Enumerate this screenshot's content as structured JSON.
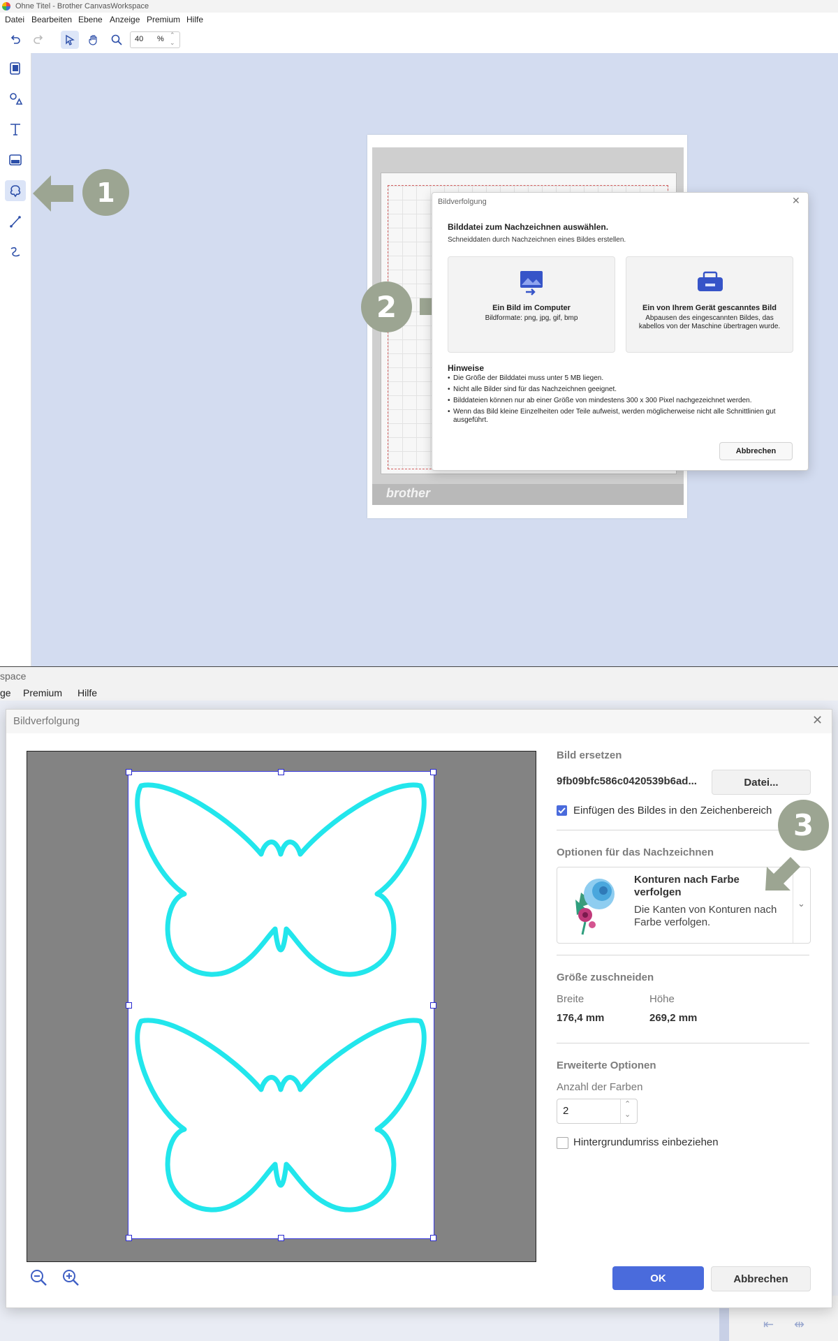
{
  "top": {
    "window_title": "Ohne Titel - Brother CanvasWorkspace",
    "menu": [
      "Datei",
      "Bearbeiten",
      "Ebene",
      "Anzeige",
      "Premium",
      "Hilfe"
    ],
    "zoom_value": "40",
    "zoom_unit": "%",
    "left_tools": [
      "pages-icon",
      "shapes-icon",
      "text-icon",
      "svg-import-icon",
      "image-trace-icon",
      "line-icon",
      "curve-icon"
    ],
    "mat_logo": "brother",
    "dialog": {
      "title": "Bildverfolgung",
      "heading": "Bilddatei zum Nachzeichnen auswählen.",
      "subheading": "Schneiddaten durch Nachzeichnen eines Bildes erstellen.",
      "option_computer": {
        "title": "Ein Bild im Computer",
        "desc": "Bildformate: png, jpg, gif, bmp"
      },
      "option_scan": {
        "title": "Ein von Ihrem Gerät gescanntes Bild",
        "desc": "Abpausen des eingescannten Bildes, das kabellos von der Maschine übertragen wurde."
      },
      "notes_heading": "Hinweise",
      "notes": [
        "Die Größe der Bilddatei muss unter 5 MB liegen.",
        "Nicht alle Bilder sind für das Nachzeichnen geeignet.",
        "Bilddateien können nur ab einer Größe von mindestens 300 x 300 Pixel nachgezeichnet werden.",
        "Wenn das Bild kleine Einzelheiten oder Teile aufweist, werden möglicherweise nicht alle Schnittlinien gut ausgeführt."
      ],
      "cancel": "Abbrechen"
    },
    "step1": "1",
    "step2": "2"
  },
  "bottom": {
    "window_title_partial": "space",
    "menu_partial": [
      "ge",
      "Premium",
      "Hilfe"
    ],
    "dialog": {
      "title": "Bildverfolgung",
      "replace_heading": "Bild ersetzen",
      "filename": "9fb09bfc586c0420539b6ad...",
      "file_button": "Datei...",
      "insert_label": "Einfügen des Bildes in den Zeichenbereich",
      "insert_checked": true,
      "options_heading": "Optionen für das Nachzeichnen",
      "option_title": "Konturen nach Farbe verfolgen",
      "option_desc": "Die Kanten von Konturen nach Farbe verfolgen.",
      "crop_heading": "Größe zuschneiden",
      "width_label": "Breite",
      "height_label": "Höhe",
      "width_value": "176,4 mm",
      "height_value": "269,2 mm",
      "advanced_heading": "Erweiterte Optionen",
      "colors_label": "Anzahl der Farben",
      "colors_value": "2",
      "background_label": "Hintergrundumriss einbeziehen",
      "background_checked": false,
      "ok": "OK",
      "cancel": "Abbrechen",
      "accent_color": "#4a6bdc",
      "outline_color": "#22e6ec"
    },
    "step3": "3"
  }
}
